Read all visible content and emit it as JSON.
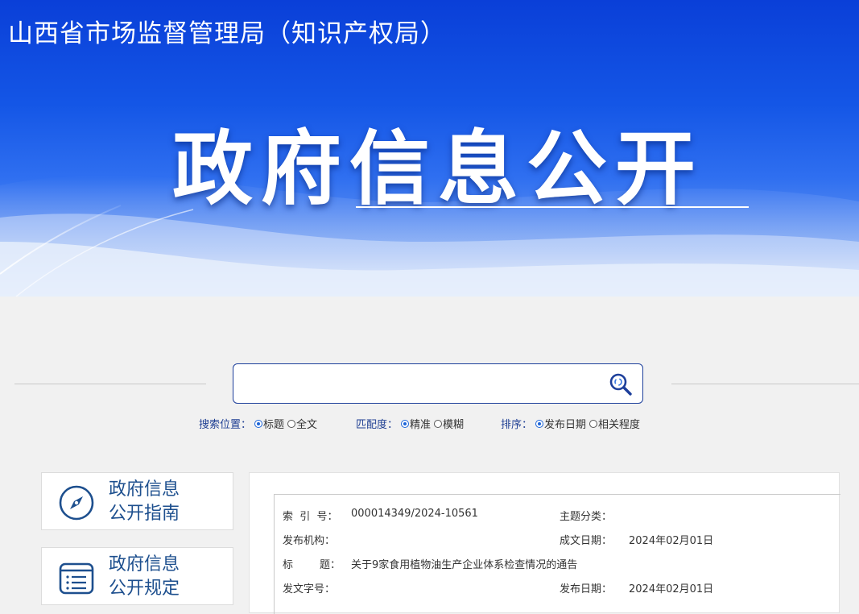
{
  "header": {
    "site_title": "山西省市场监督管理局（知识产权局）",
    "hero_title": "政府信息公开"
  },
  "search": {
    "placeholder": "",
    "button_icon": "search-icon",
    "position": {
      "label": "搜索位置：",
      "options": [
        "标题",
        "全文"
      ],
      "selected": "标题"
    },
    "match": {
      "label": "匹配度：",
      "options": [
        "精准",
        "模糊"
      ],
      "selected": "精准"
    },
    "sort": {
      "label": "排序：",
      "options": [
        "发布日期",
        "相关程度"
      ],
      "selected": "发布日期"
    }
  },
  "sidebar": {
    "items": [
      {
        "line1": "政府信息",
        "line2": "公开指南",
        "icon": "compass-icon"
      },
      {
        "line1": "政府信息",
        "line2": "公开规定",
        "icon": "document-list-icon"
      }
    ]
  },
  "meta": {
    "index_label": "索  引  号：",
    "index_value": "000014349/2024-10561",
    "category_label": "主题分类：",
    "category_value": "",
    "org_label": "发布机构：",
    "org_value": "",
    "created_label": "成文日期：",
    "created_value": "2024年02月01日",
    "title_label": "标        题：",
    "title_value": "关于9家食用植物油生产企业体系检查情况的通告",
    "docno_label": "发文字号：",
    "docno_value": "",
    "published_label": "发布日期：",
    "published_value": "2024年02月01日"
  },
  "colors": {
    "banner_blue": "#1456e6",
    "accent_navy": "#1d3f9b",
    "sidebar_text": "#1d4f8e",
    "radio_blue": "#1d65d8"
  }
}
